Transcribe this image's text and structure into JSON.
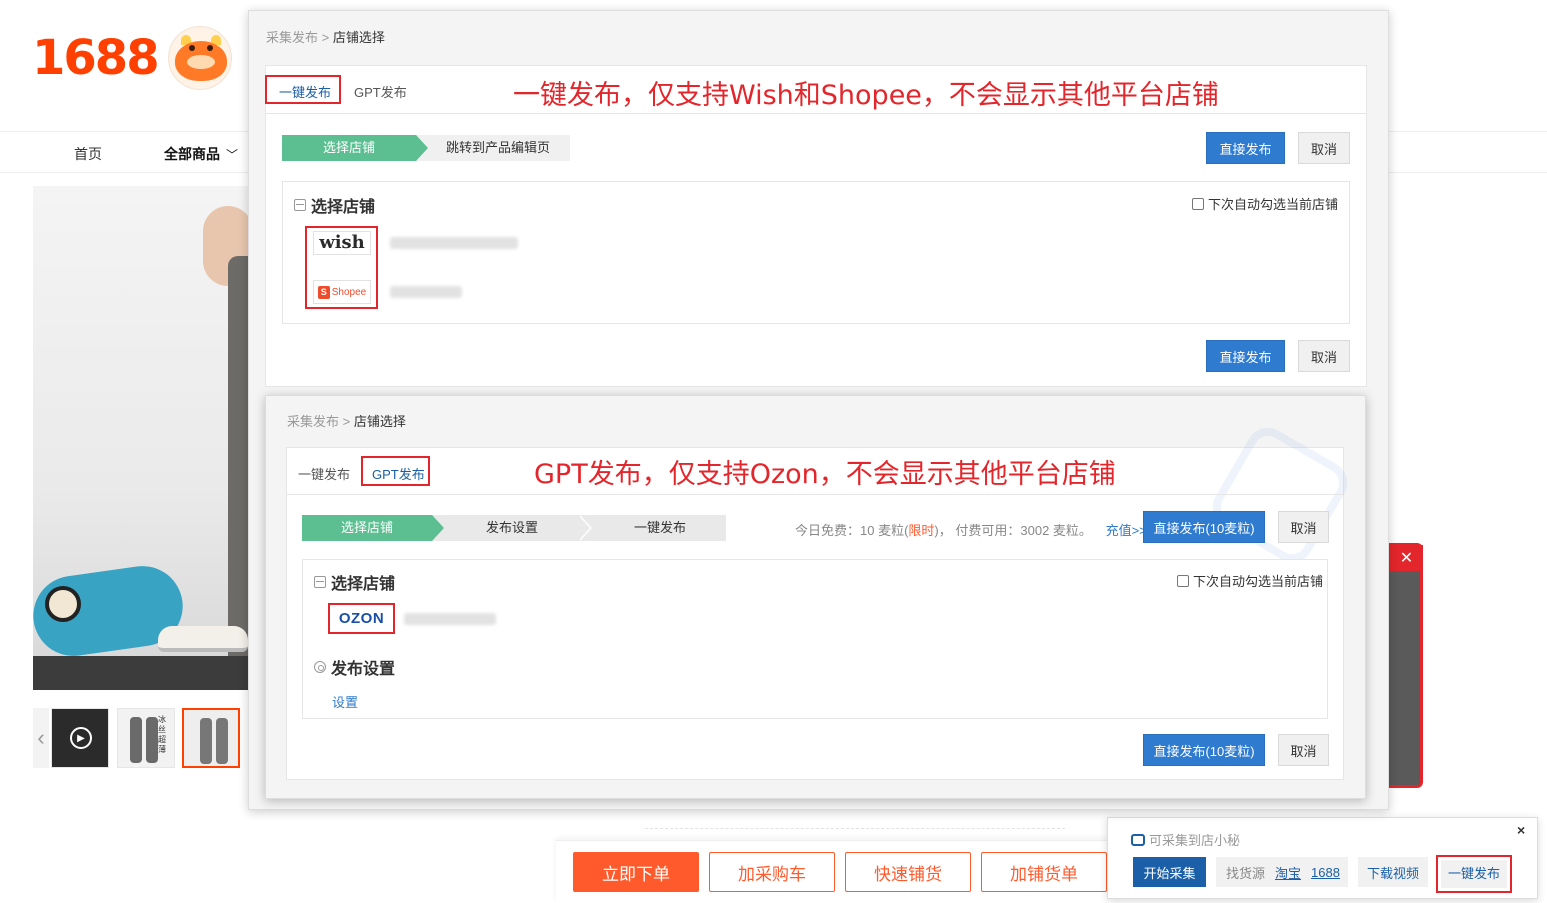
{
  "site": {
    "logo": "1688",
    "nav": {
      "home": "首页",
      "all_products": "全部商品",
      "chevron": "﹀"
    },
    "thumb_text": "冰丝 超薄",
    "buttons": {
      "order": "立即下单",
      "cart": "加采购车",
      "quick": "快速铺货",
      "add_order": "加铺货单"
    }
  },
  "dialog1": {
    "breadcrumb": {
      "parent": "采集发布",
      "sep": ">",
      "current": "店铺选择"
    },
    "tabs": [
      "一键发布",
      "GPT发布"
    ],
    "active_tab": "一键发布",
    "annotation": "一键发布，仅支持Wish和Shopee，不会显示其他平台店铺",
    "steps": [
      "选择店铺",
      "跳转到产品编辑页"
    ],
    "publish_label": "直接发布",
    "cancel_label": "取消",
    "section_title": "选择店铺",
    "auto_check_label": "下次自动勾选当前店铺",
    "stores": [
      {
        "platform": "wish",
        "logo_text": "wish"
      },
      {
        "platform": "shopee",
        "logo_text": "Shopee",
        "logo_mark": "S"
      }
    ]
  },
  "dialog2": {
    "breadcrumb": {
      "parent": "采集发布",
      "sep": ">",
      "current": "店铺选择"
    },
    "tabs": [
      "一键发布",
      "GPT发布"
    ],
    "active_tab": "GPT发布",
    "annotation": "GPT发布，仅支持Ozon，不会显示其他平台店铺",
    "steps": [
      "选择店铺",
      "发布设置",
      "一键发布"
    ],
    "quota": {
      "free_prefix": "今日免费：10 麦粒(",
      "limited": "限时",
      "free_suffix": ")，",
      "paid": "付费可用：3002 麦粒。",
      "recharge": "充值>>"
    },
    "publish_label": "直接发布(10麦粒)",
    "cancel_label": "取消",
    "section_store": "选择店铺",
    "auto_check_label": "下次自动勾选当前店铺",
    "store_logo": "OZON",
    "section_settings": "发布设置",
    "settings_link": "设置"
  },
  "widget": {
    "title": "可采集到店小秘",
    "start": "开始采集",
    "source_label": "找货源",
    "source_taobao": "淘宝",
    "source_1688": "1688",
    "download_video": "下载视频",
    "one_key": "一键发布",
    "close": "×"
  },
  "colors": {
    "brand_orange": "#ff4000",
    "step_green": "#5cbf91",
    "primary_blue": "#2e7bd0",
    "annotation_red": "#e3262b"
  }
}
